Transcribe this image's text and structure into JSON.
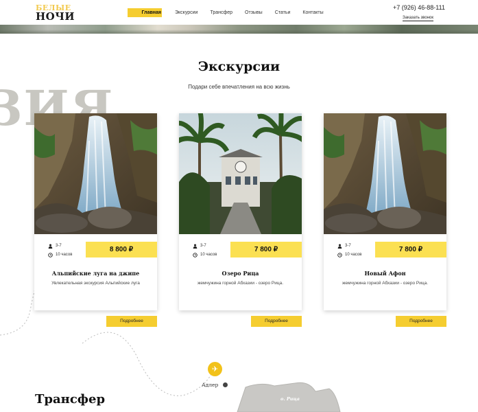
{
  "header": {
    "logo_line1": "БЕЛЫЕ",
    "logo_line2": "НОЧИ",
    "nav": [
      {
        "label": "Главная",
        "active": true
      },
      {
        "label": "Экскурсии",
        "active": false
      },
      {
        "label": "Трансфер",
        "active": false
      },
      {
        "label": "Отзывы",
        "active": false
      },
      {
        "label": "Статьи",
        "active": false
      },
      {
        "label": "Контакты",
        "active": false
      }
    ],
    "phone": "+7 (926) 46-88-111",
    "callback": "Заказать звонок"
  },
  "excursions": {
    "title": "Экскурсии",
    "subtitle": "Подари себе впечатления на всю жизнь",
    "bg_word": "ЗИЯ",
    "cards": [
      {
        "image": "waterfall",
        "people": "3-7",
        "duration": "10 часов",
        "price": "8 800 ₽",
        "title": "Альпийские луга на джипе",
        "desc": "Увлекательная экскурсия Альпийские луга",
        "button": "Подробнее"
      },
      {
        "image": "palm-building",
        "people": "3-7",
        "duration": "10 часов",
        "price": "7 800 ₽",
        "title": "Озеро Рица",
        "desc": "жемчужина горной Абхазии - озеро Рица.",
        "button": "Подробнее"
      },
      {
        "image": "waterfall",
        "people": "3-7",
        "duration": "10 часов",
        "price": "7 800 ₽",
        "title": "Новый Афон",
        "desc": "жемчужина горной Абхазии - озеро Рица.",
        "button": "Подробнее"
      }
    ]
  },
  "transfer": {
    "title": "Трансфер",
    "adler_label": "Адлер",
    "ritsa_label": "о. Рица"
  },
  "colors": {
    "accent": "#f5cd30",
    "price_bg": "#fbe052",
    "logo_top": "#f2c94c"
  }
}
